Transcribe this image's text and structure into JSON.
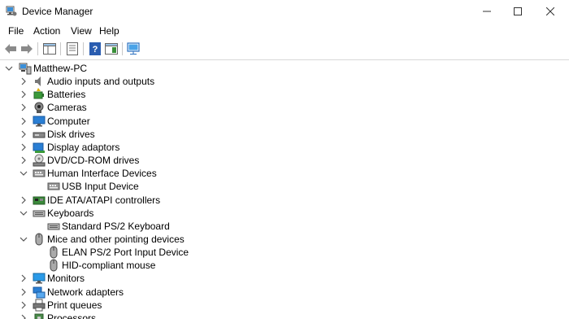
{
  "window": {
    "title": "Device Manager"
  },
  "menu": [
    "File",
    "Action",
    "View",
    "Help"
  ],
  "tree": {
    "root": "Matthew-PC",
    "categories": [
      {
        "label": "Audio inputs and outputs",
        "icon": "speaker-icon",
        "expanded": false,
        "children": []
      },
      {
        "label": "Batteries",
        "icon": "battery-icon",
        "expanded": false,
        "children": []
      },
      {
        "label": "Cameras",
        "icon": "camera-icon",
        "expanded": false,
        "children": []
      },
      {
        "label": "Computer",
        "icon": "computer-icon",
        "expanded": false,
        "children": []
      },
      {
        "label": "Disk drives",
        "icon": "disk-drive-icon",
        "expanded": false,
        "children": []
      },
      {
        "label": "Display adaptors",
        "icon": "display-adapter-icon",
        "expanded": false,
        "children": []
      },
      {
        "label": "DVD/CD-ROM drives",
        "icon": "dvd-drive-icon",
        "expanded": false,
        "children": []
      },
      {
        "label": "Human Interface Devices",
        "icon": "hid-icon",
        "expanded": true,
        "children": [
          {
            "label": "USB Input Device",
            "icon": "hid-icon"
          }
        ]
      },
      {
        "label": "IDE ATA/ATAPI controllers",
        "icon": "ide-controller-icon",
        "expanded": false,
        "children": []
      },
      {
        "label": "Keyboards",
        "icon": "keyboard-icon",
        "expanded": true,
        "children": [
          {
            "label": "Standard PS/2 Keyboard",
            "icon": "keyboard-icon"
          }
        ]
      },
      {
        "label": "Mice and other pointing devices",
        "icon": "mouse-icon",
        "expanded": true,
        "children": [
          {
            "label": "ELAN PS/2 Port Input Device",
            "icon": "mouse-icon"
          },
          {
            "label": "HID-compliant mouse",
            "icon": "mouse-icon"
          }
        ]
      },
      {
        "label": "Monitors",
        "icon": "monitor-icon",
        "expanded": false,
        "children": []
      },
      {
        "label": "Network adapters",
        "icon": "network-adapter-icon",
        "expanded": false,
        "children": []
      },
      {
        "label": "Print queues",
        "icon": "printer-icon",
        "expanded": false,
        "children": []
      },
      {
        "label": "Processors",
        "icon": "processor-icon",
        "expanded": false,
        "children": []
      }
    ]
  },
  "colors": {
    "accent": "#1e90ff",
    "icon_gray": "#6b6b6b",
    "separator": "#d9d9d9"
  }
}
